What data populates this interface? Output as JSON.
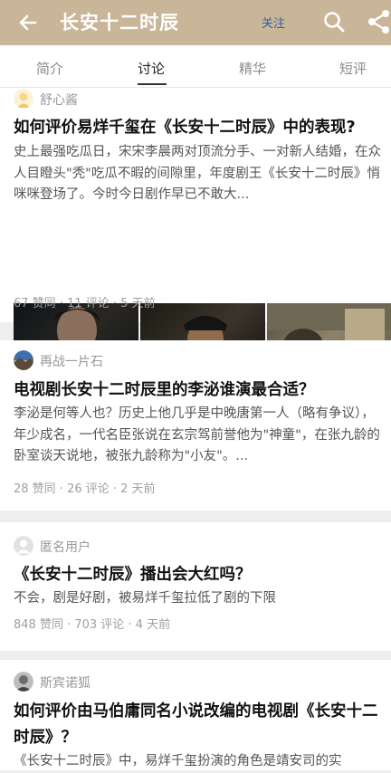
{
  "header": {
    "title": "长安十二时辰",
    "follow_label": "关注",
    "back_icon": "back-arrow-icon",
    "search_icon": "search-icon",
    "share_icon": "share-icon",
    "bg_color": "#c9b597"
  },
  "tabs": [
    {
      "label": "简介",
      "active": false
    },
    {
      "label": "讨论",
      "active": true
    },
    {
      "label": "精华",
      "active": false
    },
    {
      "label": "短评",
      "active": false
    }
  ],
  "posts": [
    {
      "author": "舒心酱",
      "title": "如何评价易烊千玺在《长安十二时辰》中的表现?",
      "excerpt": "史上最强吃瓜日，宋宋李晨两对顶流分手、一对新人结婚，在众人目瞪头\"秃\"吃瓜不暇的间隙里，年度剧王《长安十二时辰》悄咪咪登场了。今时今日剧作早已不敢大...",
      "stats": "67 赞同 · 11 评论 · 5 天前",
      "images": [
        "drama-still-young-man",
        "drama-still-man-in-hat",
        "drama-still-fight-scene"
      ]
    },
    {
      "author": "再战一片石",
      "title": "电视剧长安十二时辰里的李泌谁演最合适？",
      "excerpt": "李泌是何等人也？历史上他几乎是中晚唐第一人（略有争议），年少成名，一代名臣张说在玄宗驾前誉他为\"神童\"，在张九龄的卧室谈天说地，被张九龄称为\"小友\"。...",
      "stats": "28 赞同 · 26 评论 · 2 天前"
    },
    {
      "author": "匿名用户",
      "title": "《长安十二时辰》播出会大红吗？",
      "excerpt": "不会，剧是好剧，被易烊千玺拉低了剧的下限",
      "stats": "848 赞同 · 703 评论 · 4 天前"
    },
    {
      "author": "斯宾诺狐",
      "title": "如何评价由马伯庸同名小说改编的电视剧《长安十二时辰》？",
      "excerpt": "《长安十二时辰》中，易烊千玺扮演的角色是靖安司的实"
    }
  ]
}
